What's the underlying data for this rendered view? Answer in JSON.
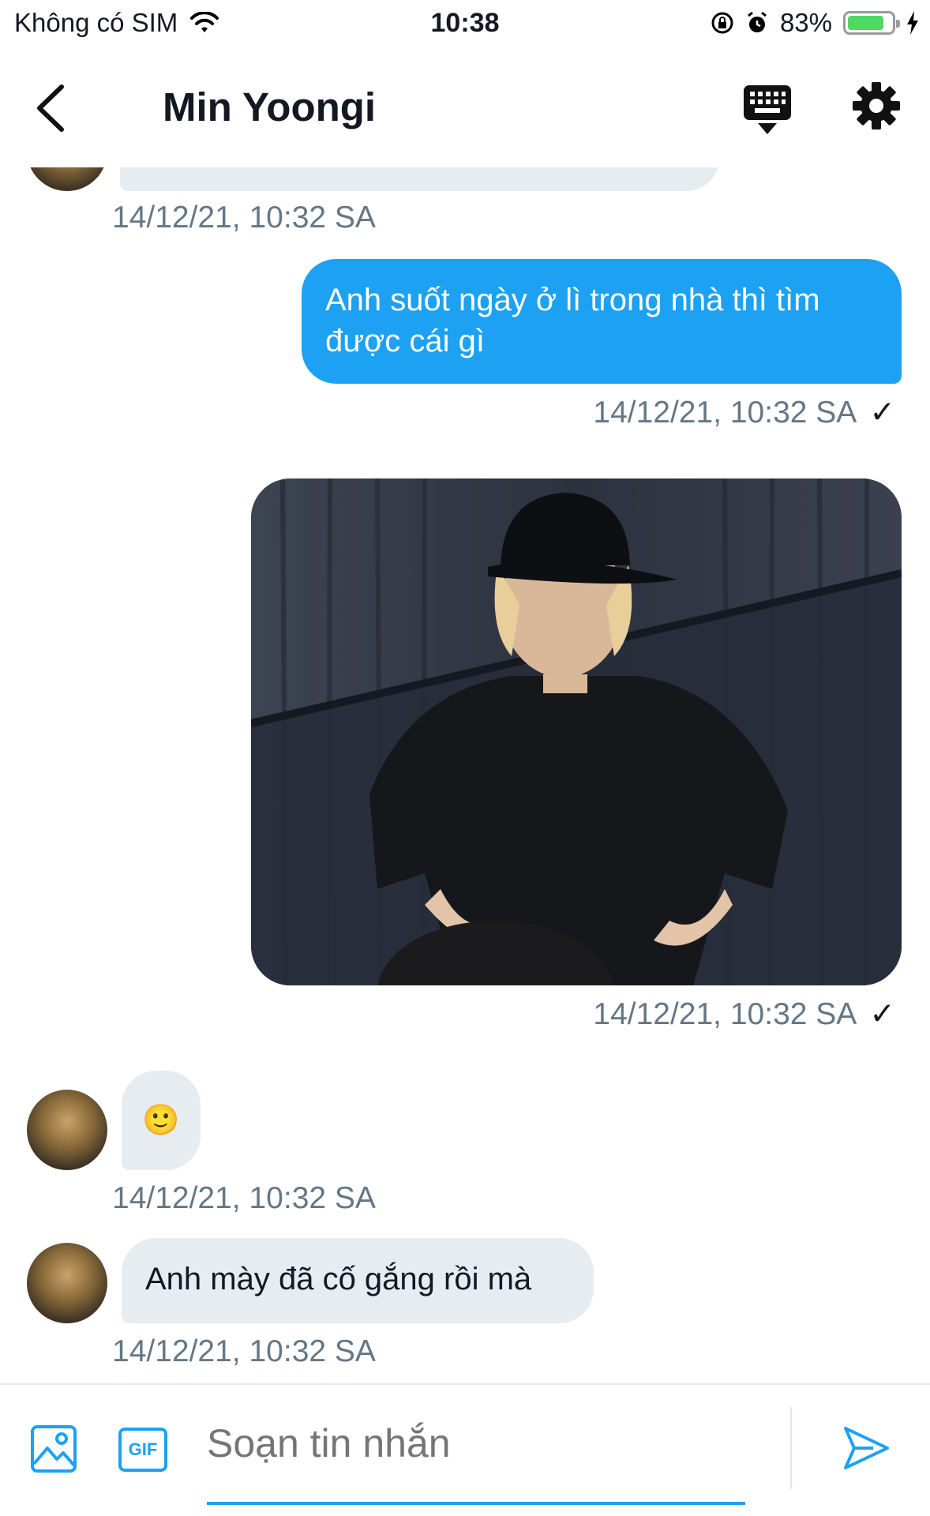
{
  "status_bar": {
    "carrier": "Không có SIM",
    "time": "10:38",
    "battery_percent": "83%",
    "battery_level": 0.83,
    "battery_color": "#4cd964"
  },
  "header": {
    "title": "Min Yoongi",
    "back_icon": "chevron-left-icon",
    "keyboard_icon": "keyboard-icon",
    "settings_icon": "gear-icon"
  },
  "messages": [
    {
      "direction": "in",
      "kind": "text",
      "text": "",
      "timestamp": "14/12/21, 10:32 SA"
    },
    {
      "direction": "out",
      "kind": "text",
      "text": "Anh suốt ngày ở lì trong nhà thì tìm được cái gì",
      "timestamp": "14/12/21, 10:32 SA",
      "read_mark": "✓"
    },
    {
      "direction": "out",
      "kind": "image",
      "timestamp": "14/12/21, 10:32 SA",
      "read_mark": "✓"
    },
    {
      "direction": "in",
      "kind": "emoji",
      "text": "🙂",
      "timestamp": "14/12/21, 10:32 SA"
    },
    {
      "direction": "in",
      "kind": "text",
      "text": "Anh mày đã cố gắng rồi mà",
      "timestamp": "14/12/21, 10:32 SA"
    }
  ],
  "composer": {
    "placeholder": "Soạn tin nhắn",
    "image_icon": "image-icon",
    "gif_label": "GIF",
    "send_icon": "send-icon",
    "accent_color": "#1da1f2"
  }
}
